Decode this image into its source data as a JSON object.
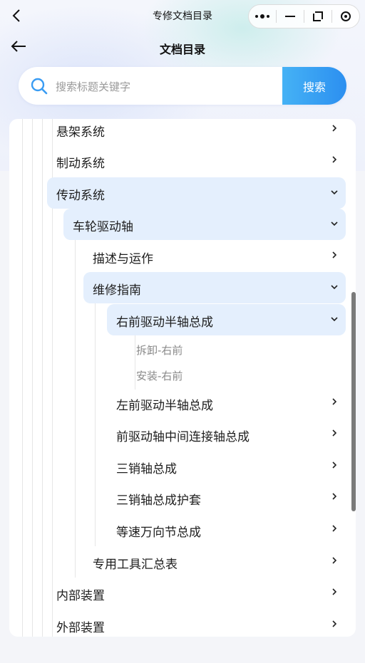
{
  "window": {
    "title": "专修文档目录"
  },
  "header": {
    "title": "文档目录"
  },
  "search": {
    "placeholder": "搜索标题关键字",
    "button_label": "搜索"
  },
  "tree": {
    "items": [
      {
        "label": "悬架系统",
        "state": "collapsed"
      },
      {
        "label": "制动系统",
        "state": "collapsed"
      },
      {
        "label": "传动系统",
        "state": "expanded"
      },
      {
        "label": "车轮驱动轴",
        "state": "expanded"
      },
      {
        "label": "描述与运作",
        "state": "collapsed"
      },
      {
        "label": "维修指南",
        "state": "expanded"
      },
      {
        "label": "右前驱动半轴总成",
        "state": "expanded"
      },
      {
        "label": "拆卸-右前",
        "state": "leaf"
      },
      {
        "label": "安装-右前",
        "state": "leaf"
      },
      {
        "label": "左前驱动半轴总成",
        "state": "collapsed"
      },
      {
        "label": "前驱动轴中间连接轴总成",
        "state": "collapsed"
      },
      {
        "label": "三销轴总成",
        "state": "collapsed"
      },
      {
        "label": "三销轴总成护套",
        "state": "collapsed"
      },
      {
        "label": "等速万向节总成",
        "state": "collapsed"
      },
      {
        "label": "专用工具汇总表",
        "state": "collapsed"
      },
      {
        "label": "内部装置",
        "state": "collapsed"
      },
      {
        "label": "外部装置",
        "state": "collapsed"
      }
    ]
  },
  "colors": {
    "accent": "#2c8ff0",
    "highlight": "#e4effd"
  }
}
